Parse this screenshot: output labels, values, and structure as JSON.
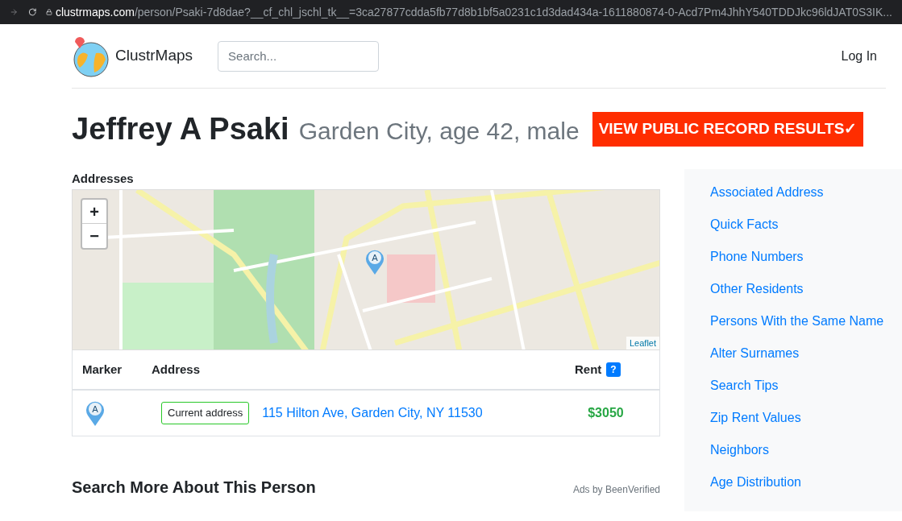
{
  "browser": {
    "url_host": "clustrmaps.com",
    "url_path": "/person/Psaki-7d8dae?__cf_chl_jschl_tk__=3ca27877cdda5fb77d8b1bf5a0231c1d3dad434a-1611880874-0-Acd7Pm4JhhY540TDDJkc96ldJAT0S3IK..."
  },
  "header": {
    "brand": "ClustrMaps",
    "search": {
      "placeholder": "Search..."
    },
    "login": "Log In"
  },
  "person": {
    "name": "Jeffrey A Psaki",
    "details": "Garden City, age 42, male",
    "cta": "VIEW PUBLIC RECORD RESULTS✓"
  },
  "addresses": {
    "title": "Addresses",
    "map": {
      "zoom_in": "+",
      "zoom_out": "−",
      "attribution": "Leaflet",
      "marker": "A"
    },
    "columns": [
      "Marker",
      "Address",
      "Rent"
    ],
    "rent_help": "?",
    "rows": [
      {
        "marker": "A",
        "tag": "Current address",
        "address": "115 Hilton Ave, Garden City, NY 11530",
        "rent": "$3050"
      }
    ]
  },
  "more": {
    "title": "Search More About This Person",
    "ads": "Ads by BeenVerified"
  },
  "sidebar": {
    "items": [
      "Associated Address",
      "Quick Facts",
      "Phone Numbers",
      "Other Residents",
      "Persons With the Same Name",
      "Alter Surnames",
      "Search Tips",
      "Zip Rent Values",
      "Neighbors",
      "Age Distribution"
    ]
  }
}
